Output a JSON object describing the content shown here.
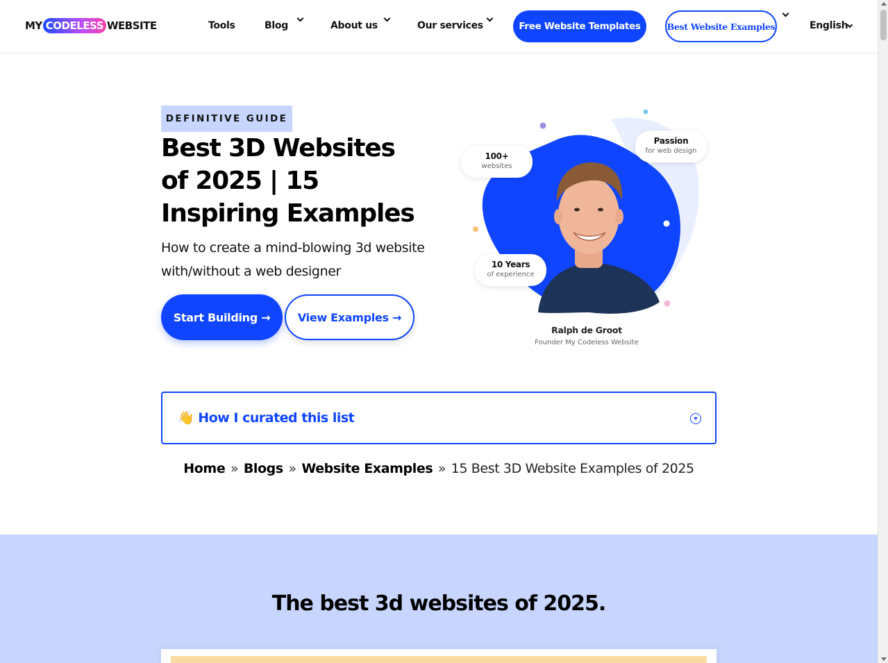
{
  "header": {
    "logo": {
      "left": "MY",
      "pill": "CODELESS",
      "right": "WEBSITE"
    },
    "nav": [
      {
        "label": "Tools",
        "has_dropdown": false
      },
      {
        "label": "Blog",
        "has_dropdown": true
      },
      {
        "label": "About us",
        "has_dropdown": true
      },
      {
        "label": "Our services",
        "has_dropdown": true
      }
    ],
    "cta_primary": "Free Website Templates",
    "cta_secondary": "Best Website Examples",
    "language": "English"
  },
  "hero": {
    "eyebrow": "DEFINITIVE GUIDE",
    "title": "Best 3D Websites of 2025 | 15 Inspiring Examples",
    "subtitle": "How to create a mind-blowing 3d website with/without a web designer",
    "btn_start": "Start Building →",
    "btn_view": "View Examples →"
  },
  "illustration": {
    "badge_sites_value": "100+",
    "badge_sites_label": "websites",
    "badge_passion_value": "Passion",
    "badge_passion_label": "for web design",
    "badge_years_value": "10 Years",
    "badge_years_label": "of experience",
    "founder_name": "Ralph de Groot",
    "founder_role": "Founder My Codeless Website",
    "colors": {
      "blob": "#0f45ff",
      "blob_back": "#e9efff"
    }
  },
  "accordion": {
    "emoji": "👋",
    "title": "How I curated this list"
  },
  "breadcrumb": {
    "items": [
      "Home",
      "Blogs",
      "Website Examples"
    ],
    "separator": "»",
    "current": "15 Best 3D Website Examples of 2025"
  },
  "section": {
    "title": "The best 3d websites of 2025."
  },
  "colors": {
    "accent": "#0f45ff",
    "section_bg": "#c8d6ff",
    "eyebrow_bg": "#c8d6ff"
  }
}
